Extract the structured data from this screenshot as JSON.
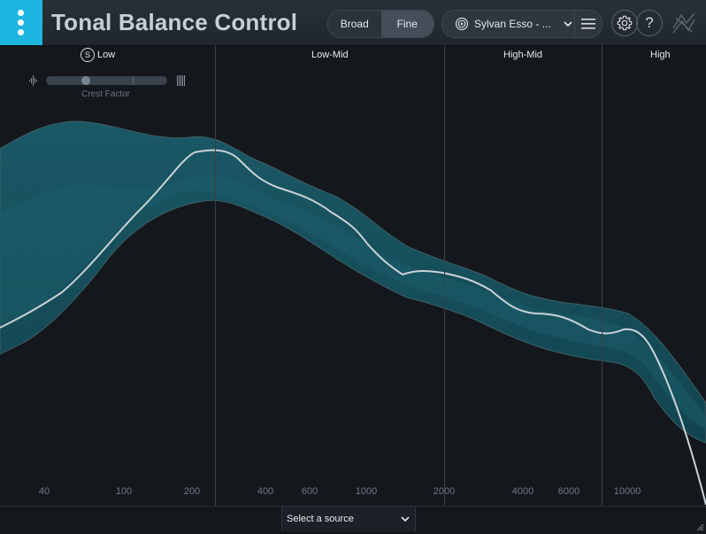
{
  "app": {
    "title": "Tonal Balance Control"
  },
  "view_toggle": {
    "broad_label": "Broad",
    "fine_label": "Fine",
    "active": "Fine"
  },
  "target": {
    "label": "Sylvan Esso - ..."
  },
  "bands": {
    "low": "Low",
    "low_mid": "Low-Mid",
    "high_mid": "High-Mid",
    "high": "High",
    "solo_icon_text": "S"
  },
  "crest": {
    "label": "Crest Factor"
  },
  "freq_labels": [
    "40",
    "100",
    "200",
    "400",
    "600",
    "1000",
    "2000",
    "4000",
    "6000",
    "10000"
  ],
  "footer": {
    "source_label": "Select a source"
  },
  "colors": {
    "accent": "#1eb6e0",
    "band_fill": "#123c45",
    "band_inner": "#1b5560",
    "curve": "#c9d2d8"
  },
  "help_glyph": "?"
}
